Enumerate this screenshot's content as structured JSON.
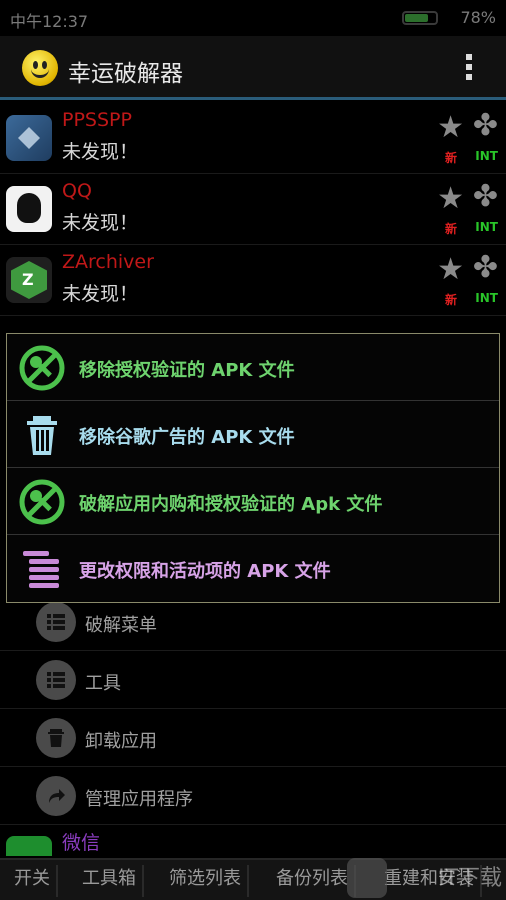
{
  "status_bar": {
    "time": "中午12:37",
    "battery_percent": "78%",
    "battery_level": 0.78
  },
  "app_bar": {
    "title": "幸运破解器"
  },
  "apps": [
    {
      "name": "PPSSPP",
      "status": "未发现！",
      "tag_new": "新",
      "tag_int": "INT"
    },
    {
      "name": "QQ",
      "status": "未发现！",
      "tag_new": "新",
      "tag_int": "INT"
    },
    {
      "name": "ZArchiver",
      "status": "未发现！",
      "tag_new": "新",
      "tag_int": "INT"
    }
  ],
  "popup": {
    "items": [
      {
        "label": "移除授权验证的 APK 文件",
        "icon": "no-key-icon"
      },
      {
        "label": "移除谷歌广告的 APK 文件",
        "icon": "trash-icon"
      },
      {
        "label": "破解应用内购和授权验证的 Apk 文件",
        "icon": "no-key-icon"
      },
      {
        "label": "更改权限和活动项的 APK 文件",
        "icon": "permissions-list-icon"
      }
    ]
  },
  "menu": {
    "items": [
      {
        "label": "破解菜单",
        "icon": "list-icon"
      },
      {
        "label": "工具",
        "icon": "list-icon"
      },
      {
        "label": "卸载应用",
        "icon": "trash-icon"
      },
      {
        "label": "管理应用程序",
        "icon": "share-arrow-icon"
      }
    ]
  },
  "partial_app": {
    "name": "微信"
  },
  "bottom_tabs": [
    "开关",
    "工具箱",
    "筛选列表",
    "备份列表",
    "重建和安装"
  ],
  "watermark": "IT下载",
  "colors": {
    "accent": "#2a5c7a",
    "app_name": "#c01818",
    "popup_green": "#6ed36e",
    "popup_blue": "#a8dced",
    "popup_purple": "#d7a3e7"
  }
}
